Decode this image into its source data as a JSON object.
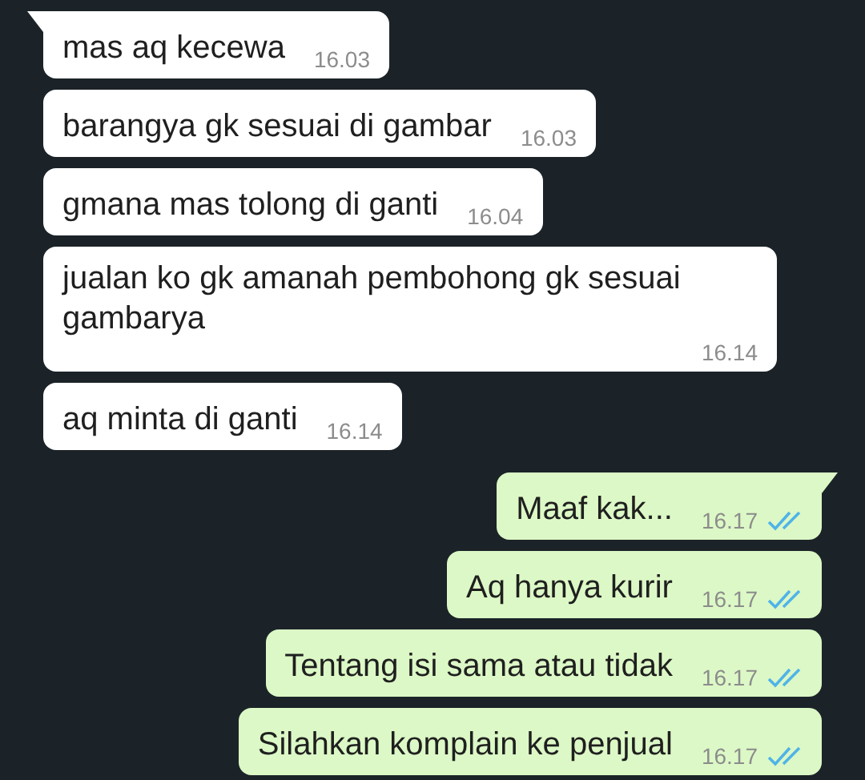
{
  "messages": [
    {
      "outgoing": false,
      "tail": true,
      "text": "mas aq kecewa",
      "time": "16.03"
    },
    {
      "outgoing": false,
      "tail": false,
      "text": "barangya gk sesuai di gambar",
      "time": "16.03"
    },
    {
      "outgoing": false,
      "tail": false,
      "text": "gmana mas tolong di ganti",
      "time": "16.04"
    },
    {
      "outgoing": false,
      "tail": false,
      "text": "jualan ko gk amanah pembohong gk sesuai gambarya",
      "time": "16.14"
    },
    {
      "outgoing": false,
      "tail": false,
      "text": "aq minta di ganti",
      "time": "16.14"
    },
    {
      "outgoing": true,
      "tail": true,
      "text": "Maaf kak...",
      "time": "16.17",
      "read": true
    },
    {
      "outgoing": true,
      "tail": false,
      "text": "Aq hanya kurir",
      "time": "16.17",
      "read": true
    },
    {
      "outgoing": true,
      "tail": false,
      "text": "Tentang isi sama atau tidak",
      "time": "16.17",
      "read": true
    },
    {
      "outgoing": true,
      "tail": false,
      "text": "Silahkan komplain ke penjual",
      "time": "16.17",
      "read": true
    }
  ]
}
